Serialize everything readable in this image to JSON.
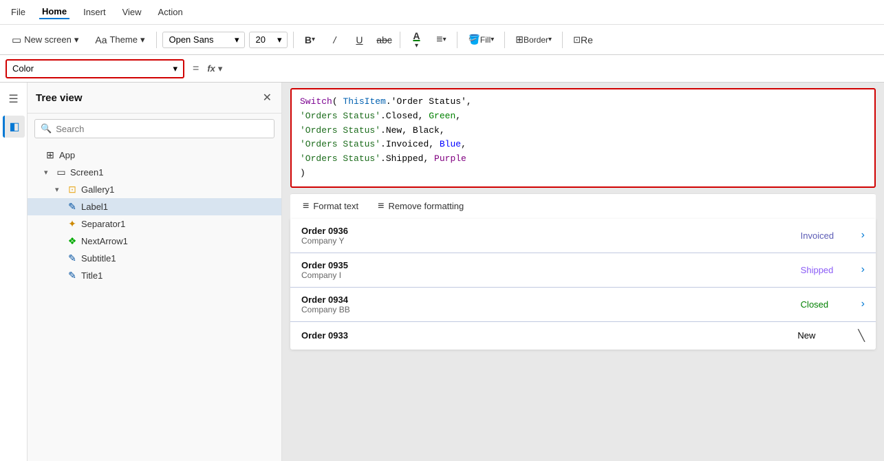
{
  "menubar": {
    "items": [
      {
        "label": "File",
        "active": false
      },
      {
        "label": "Home",
        "active": true
      },
      {
        "label": "Insert",
        "active": false
      },
      {
        "label": "View",
        "active": false
      },
      {
        "label": "Action",
        "active": false
      }
    ]
  },
  "toolbar": {
    "new_screen_label": "New screen",
    "theme_label": "Theme",
    "font_label": "Open Sans",
    "font_size": "20",
    "bold_label": "B",
    "italic_label": "/",
    "underline_label": "U",
    "strikethrough_label": "abc",
    "font_color_label": "A",
    "align_label": "≡",
    "fill_label": "Fill",
    "border_label": "Border",
    "reorder_label": "Re"
  },
  "property_bar": {
    "dropdown_label": "Color",
    "equals": "=",
    "fx_label": "fx"
  },
  "formula": {
    "line1": "Switch( ThisItem.'Order Status',",
    "line2": "    'Orders Status'.Closed, Green,",
    "line3": "    'Orders Status'.New, Black,",
    "line4": "    'Orders Status'.Invoiced, Blue,",
    "line5": "    'Orders Status'.Shipped, Purple",
    "line6": ")"
  },
  "format_toolbar": {
    "format_text_label": "Format text",
    "remove_formatting_label": "Remove formatting"
  },
  "tree_view": {
    "title": "Tree view",
    "search_placeholder": "Search",
    "items": [
      {
        "label": "App",
        "icon": "app",
        "indent": 0,
        "has_arrow": false
      },
      {
        "label": "Screen1",
        "icon": "screen",
        "indent": 1,
        "has_arrow": true,
        "expanded": true
      },
      {
        "label": "Gallery1",
        "icon": "gallery",
        "indent": 2,
        "has_arrow": true,
        "expanded": true
      },
      {
        "label": "Label1",
        "icon": "label",
        "indent": 3,
        "has_arrow": false,
        "selected": true
      },
      {
        "label": "Separator1",
        "icon": "separator",
        "indent": 3,
        "has_arrow": false
      },
      {
        "label": "NextArrow1",
        "icon": "nextarrow",
        "indent": 3,
        "has_arrow": false
      },
      {
        "label": "Subtitle1",
        "icon": "label",
        "indent": 3,
        "has_arrow": false
      },
      {
        "label": "Title1",
        "icon": "label",
        "indent": 3,
        "has_arrow": false
      }
    ]
  },
  "gallery": {
    "rows": [
      {
        "order": "Order 0936",
        "company": "Company Y",
        "status": "Invoiced",
        "status_class": "status-invoiced",
        "has_arrow": true
      },
      {
        "order": "Order 0935",
        "company": "Company I",
        "status": "Shipped",
        "status_class": "status-shipped",
        "has_arrow": true
      },
      {
        "order": "Order 0934",
        "company": "Company BB",
        "status": "Closed",
        "status_class": "status-closed",
        "has_arrow": true
      },
      {
        "order": "Order 0933",
        "company": "",
        "status": "New",
        "status_class": "status-new",
        "has_arrow": false
      }
    ]
  },
  "icons": {
    "hamburger": "☰",
    "search": "🔍",
    "close": "✕",
    "chevron_down": "▾",
    "chevron_right": "›",
    "chevron_left": "◂",
    "layers": "◧",
    "app_icon": "⊞",
    "screen_icon": "▭",
    "label_icon": "✎",
    "separator_icon": "⁞",
    "nextarrow_icon": "❖",
    "gallery_icon": "⊡",
    "arrow_right": "›",
    "arrow_right_dark": "╲"
  }
}
